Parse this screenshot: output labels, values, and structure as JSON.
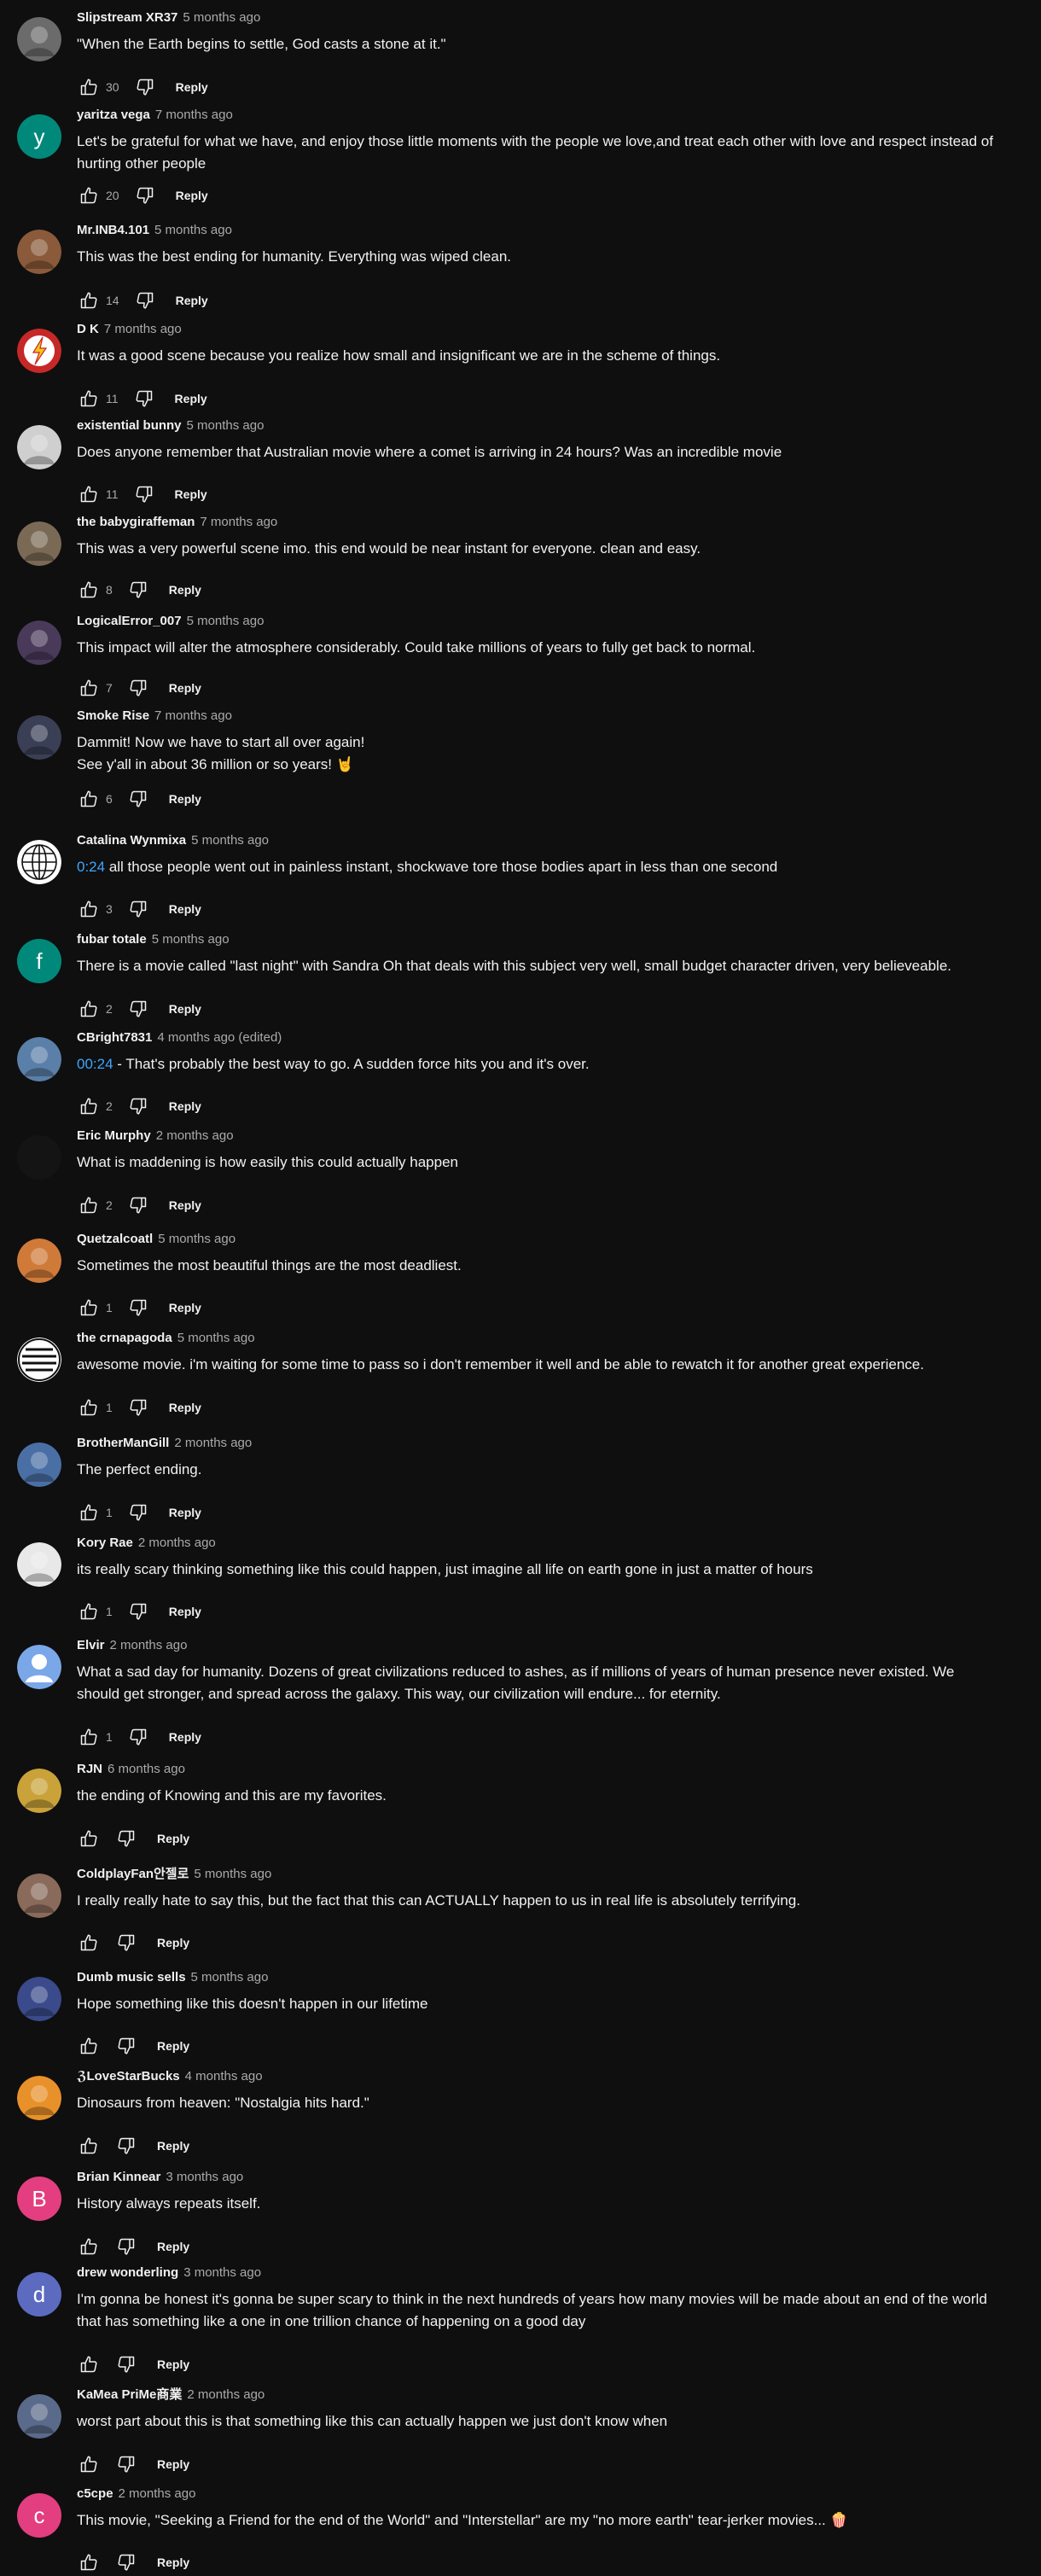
{
  "reply_label": "Reply",
  "icons": {
    "like": "thumb-up-outline-icon",
    "dislike": "thumb-down-outline-icon"
  },
  "comments": [
    {
      "author": "Slipstream XR37",
      "time": "5 months ago",
      "text": "\"When the Earth begins to settle, God casts a stone at it.\"",
      "likes": "30",
      "avatar": {
        "type": "photo",
        "color": "#6b6b6b"
      }
    },
    {
      "author": "yaritza vega",
      "time": "7 months ago",
      "text": "Let's be grateful for what we have, and enjoy those little moments with the people we love,and treat each other with love and respect instead of hurting other people",
      "likes": "20",
      "avatar": {
        "type": "letter",
        "letter": "y",
        "color": "#00897b"
      }
    },
    {
      "author": "Mr.INB4.101",
      "time": "5 months ago",
      "text": "This was the best ending for humanity. Everything was wiped clean.",
      "likes": "14",
      "avatar": {
        "type": "photo",
        "color": "#8a5a3a"
      }
    },
    {
      "author": "D K",
      "time": "7 months ago",
      "text": "It was a good scene because you realize how small and insignificant we are in the scheme of things.",
      "likes": "11",
      "avatar": {
        "type": "flash",
        "color": "#c62828"
      }
    },
    {
      "author": "existential bunny",
      "time": "5 months ago",
      "text": "Does anyone remember that Australian movie where a comet is arriving in 24 hours? Was an incredible movie",
      "likes": "11",
      "avatar": {
        "type": "photo",
        "color": "#cfcfcf"
      }
    },
    {
      "author": "the babygiraffeman",
      "time": "7 months ago",
      "text": "This was a very powerful scene imo.  this end would be near instant for everyone.  clean and easy.",
      "likes": "8",
      "avatar": {
        "type": "photo",
        "color": "#7a6a55"
      }
    },
    {
      "author": "LogicalError_007",
      "time": "5 months ago",
      "text": "This impact will alter the atmosphere considerably. Could take millions of years to fully get back to normal.",
      "likes": "7",
      "avatar": {
        "type": "photo",
        "color": "#4a3a5a"
      }
    },
    {
      "author": "Smoke Rise",
      "time": "7 months ago",
      "text": "Dammit! Now we have to start all over again!\nSee y'all in about 36 million or so years! 🤘",
      "likes": "6",
      "avatar": {
        "type": "photo",
        "color": "#3a3f55"
      }
    },
    {
      "author": "Catalina Wynmixa",
      "time": "5 months ago",
      "timestamp": "0:24",
      "text": " all those people went out in painless instant, shockwave tore those bodies apart in less than one second",
      "likes": "3",
      "avatar": {
        "type": "globe",
        "color": "#ffffff"
      }
    },
    {
      "author": "fubar totale",
      "time": "5 months ago",
      "text": "There is a movie called \"last night\" with Sandra Oh that deals with this subject very well, small budget character driven, very believeable.",
      "likes": "2",
      "avatar": {
        "type": "letter",
        "letter": "f",
        "color": "#00897b"
      }
    },
    {
      "author": "CBright7831",
      "time": "4 months ago (edited)",
      "timestamp": "00:24",
      "text": " - That's probably the best way to go. A sudden force hits you and it's over.",
      "likes": "2",
      "avatar": {
        "type": "photo",
        "color": "#5a7fa8"
      }
    },
    {
      "author": "Eric Murphy",
      "time": "2 months ago",
      "text": "What is maddening is how easily this could actually happen",
      "likes": "2",
      "avatar": {
        "type": "blank",
        "color": "#141414"
      }
    },
    {
      "author": "Quetzalcoatl",
      "time": "5 months ago",
      "text": "Sometimes the most beautiful things are the most deadliest.",
      "likes": "1",
      "avatar": {
        "type": "photo",
        "color": "#d07a3a"
      }
    },
    {
      "author": "the crnapagoda",
      "time": "5 months ago",
      "text": "awesome movie. i'm waiting for some time to pass so i don't remember it well and be able to rewatch it for another great experience.",
      "likes": "1",
      "avatar": {
        "type": "stripes",
        "color": "#ffffff"
      }
    },
    {
      "author": "BrotherManGill",
      "time": "2 months ago",
      "text": "The perfect ending.",
      "likes": "1",
      "avatar": {
        "type": "photo",
        "color": "#4a6fa5"
      }
    },
    {
      "author": "Kory Rae",
      "time": "2 months ago",
      "text": "its really scary thinking something like this could happen, just imagine all life on earth gone in just a matter of hours",
      "likes": "1",
      "avatar": {
        "type": "photo",
        "color": "#e8e8e8"
      }
    },
    {
      "author": "Elvir",
      "time": "2 months ago",
      "text": "What a sad day for humanity. Dozens of great civilizations reduced to ashes, as if millions of years of human presence never existed. We should get stronger, and spread across the galaxy. This way, our civilization will endure... for eternity.",
      "likes": "1",
      "avatar": {
        "type": "person",
        "color": "#7aa7e8"
      }
    },
    {
      "author": "RJN",
      "time": "6 months ago",
      "text": "the ending of Knowing and this are my favorites.",
      "likes": "",
      "avatar": {
        "type": "photo",
        "color": "#c9a23a"
      }
    },
    {
      "author": "ColdplayFan안젤로",
      "time": "5 months ago",
      "text": "I really really hate to say this, but the fact that this can ACTUALLY happen to us in real life is absolutely terrifying.",
      "likes": "",
      "avatar": {
        "type": "photo",
        "color": "#8a6a5a"
      }
    },
    {
      "author": "Dumb music sells",
      "time": "5 months ago",
      "text": "Hope something like this doesn't happen in our lifetime",
      "likes": "",
      "avatar": {
        "type": "photo",
        "color": "#3a4a8a"
      }
    },
    {
      "author": "ℨLoveStarBucks",
      "time": "4 months ago",
      "text": "Dinosaurs from heaven: \"Nostalgia hits hard.\"",
      "likes": "",
      "avatar": {
        "type": "photo",
        "color": "#e8902a"
      }
    },
    {
      "author": "Brian Kinnear",
      "time": "3 months ago",
      "text": "History always repeats itself.",
      "likes": "",
      "avatar": {
        "type": "letter",
        "letter": "B",
        "color": "#e33e7f"
      }
    },
    {
      "author": "drew wonderling",
      "time": "3 months ago",
      "text": "I'm gonna be honest it's gonna be super scary to think in the next hundreds of years how many movies will be made about an end of the world that has something like a one in one trillion chance of happening on a good day",
      "likes": "",
      "avatar": {
        "type": "letter",
        "letter": "d",
        "color": "#5c6bc0"
      }
    },
    {
      "author": "KaMea PriMe商業",
      "time": "2 months ago",
      "text": "worst part about this is that something like this can actually happen we just don't know when",
      "likes": "",
      "avatar": {
        "type": "photo",
        "color": "#5a6a8a"
      }
    },
    {
      "author": "c5cpe",
      "time": "2 months ago",
      "text": "This movie, \"Seeking a Friend for the end of the World\" and \"Interstellar\" are my \"no more earth\" tear-jerker movies... 🍿",
      "likes": "",
      "avatar": {
        "type": "letter",
        "letter": "c",
        "color": "#e33e7f"
      }
    }
  ]
}
